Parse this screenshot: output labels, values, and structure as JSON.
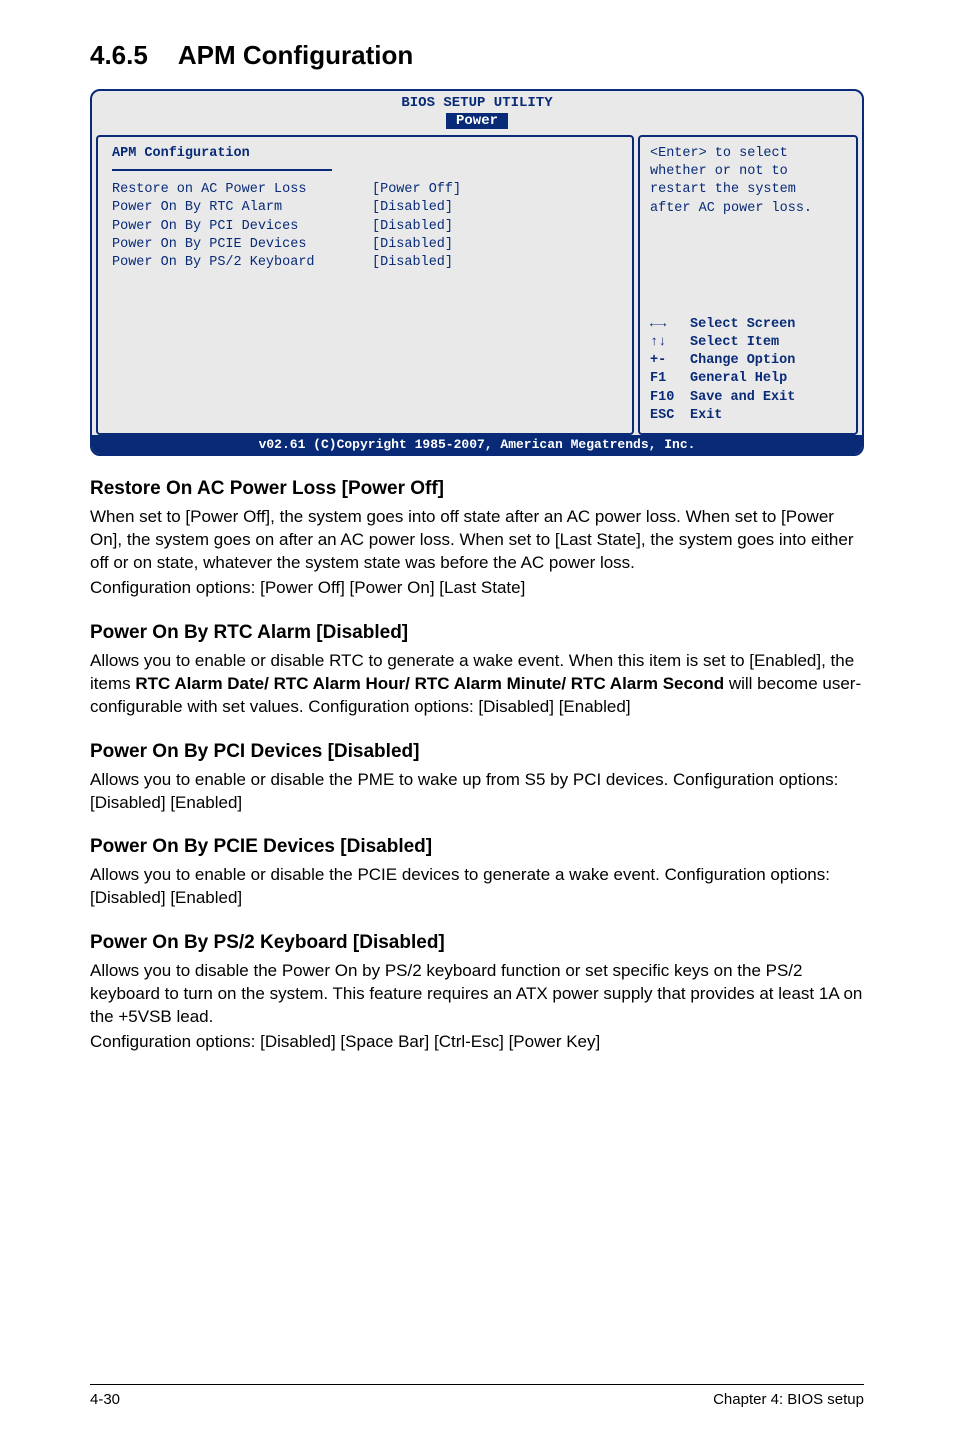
{
  "heading": {
    "number": "4.6.5",
    "title": "APM Configuration"
  },
  "bios": {
    "title_line1": "BIOS SETUP UTILITY",
    "tab": "Power",
    "panel_title": "APM Configuration",
    "rows": [
      {
        "label": "Restore on AC Power Loss",
        "value": "[Power Off]"
      },
      {
        "label": "Power On By RTC Alarm",
        "value": "[Disabled]"
      },
      {
        "label": "Power On By PCI Devices",
        "value": "[Disabled]"
      },
      {
        "label": "Power On By PCIE Devices",
        "value": "[Disabled]"
      },
      {
        "label": "Power On By PS/2 Keyboard",
        "value": "[Disabled]"
      }
    ],
    "help_l1": "<Enter> to select",
    "help_l2": "whether or not to",
    "help_l3": "restart the system",
    "help_l4": "after AC power loss.",
    "nav": {
      "k1": "←→",
      "v1": "Select Screen",
      "k2": "↑↓",
      "v2": "Select Item",
      "k3": "+-",
      "v3": "Change Option",
      "k4": "F1",
      "v4": "General Help",
      "k5": "F10",
      "v5": "Save and Exit",
      "k6": "ESC",
      "v6": "Exit"
    },
    "footer": "v02.61 (C)Copyright 1985-2007, American Megatrends, Inc."
  },
  "sections": {
    "s1": {
      "title": "Restore On AC Power Loss [Power Off]",
      "p1": "When set to [Power Off], the system goes into off state after an AC power loss. When set to [Power On], the system goes on after an AC power loss. When set to [Last State], the system goes into either off or on state, whatever the system state was before the AC power loss.",
      "p2": "Configuration options: [Power Off] [Power On] [Last State]"
    },
    "s2": {
      "title": "Power On By RTC Alarm [Disabled]",
      "p1a": "Allows you to enable or disable RTC to generate a wake event. When this item is set to [Enabled], the items ",
      "p1b": "RTC Alarm Date/ RTC Alarm Hour/ RTC Alarm Minute/ RTC Alarm Second",
      "p1c": " will become user-configurable with set values. Configuration options: [Disabled] [Enabled]"
    },
    "s3": {
      "title": "Power On By PCI Devices [Disabled]",
      "p1": "Allows you to enable or disable the PME to wake up from S5 by PCI devices. Configuration options: [Disabled] [Enabled]"
    },
    "s4": {
      "title": "Power On By PCIE Devices [Disabled]",
      "p1": "Allows you to enable or disable the PCIE devices to generate a wake event. Configuration options: [Disabled] [Enabled]"
    },
    "s5": {
      "title": "Power On By PS/2 Keyboard [Disabled]",
      "p1": "Allows you to disable the Power On by PS/2 keyboard function or set specific keys on the PS/2 keyboard to turn on the system. This feature requires an ATX power supply that provides at least 1A on the +5VSB lead.",
      "p2": "Configuration options: [Disabled] [Space Bar] [Ctrl-Esc] [Power Key]"
    }
  },
  "footer": {
    "left": "4-30",
    "right": "Chapter 4: BIOS setup"
  }
}
